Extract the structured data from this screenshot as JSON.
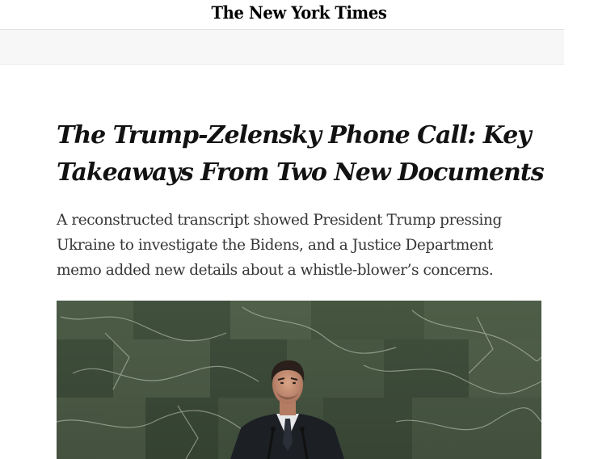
{
  "masthead": {
    "logo_text": "The New York Times"
  },
  "article": {
    "headline": "The Trump-Zelensky Phone Call: Key Takeaways From Two New Documents",
    "summary": "A reconstructed transcript showed President Trump pressing Ukraine to investigate the Bidens, and a Justice Department memo added new details about a whistle-blower’s concerns."
  },
  "colors": {
    "text": "#121212",
    "summary_text": "#363636",
    "nav_background": "#f7f7f7",
    "marble_wall": "#4a5a44"
  }
}
